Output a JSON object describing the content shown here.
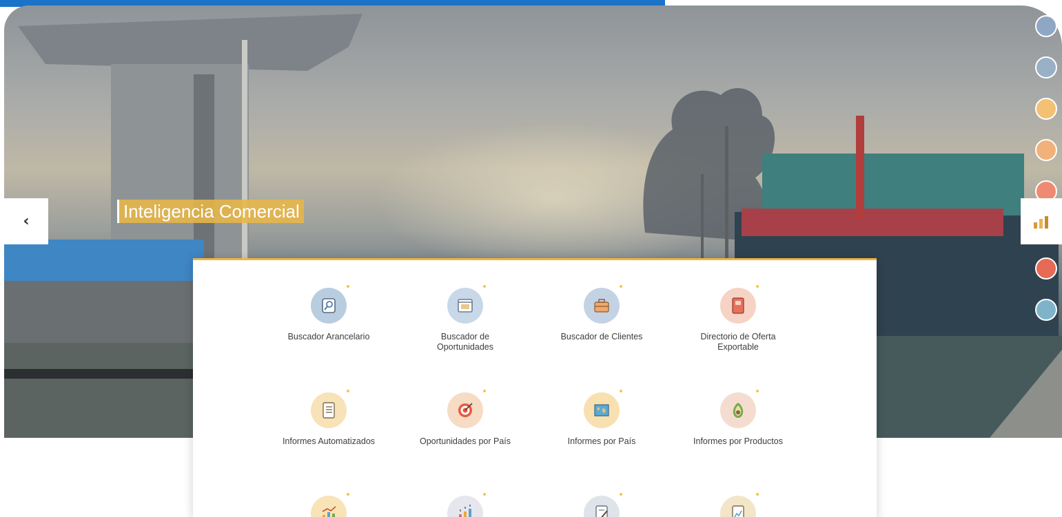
{
  "hero": {
    "title": "Inteligencia Comercial",
    "prev_arrow": "‹"
  },
  "right_nav": [
    {
      "icon": "search-doc-icon",
      "color": "#8fa7c4"
    },
    {
      "icon": "browser-window-icon",
      "color": "#9ab0c6"
    },
    {
      "icon": "report-list-icon",
      "color": "#f2c173"
    },
    {
      "icon": "briefcase-icon",
      "color": "#f0b27a"
    },
    {
      "icon": "directory-book-icon",
      "color": "#ef8a72"
    },
    {
      "icon": "bar-chart-icon",
      "color": "#e8b455"
    },
    {
      "icon": "target-icon",
      "color": "#e66a55"
    },
    {
      "icon": "world-map-icon",
      "color": "#7fb3c9"
    }
  ],
  "tools": [
    {
      "label": "Buscador Arancelario",
      "icon": "search-doc-icon",
      "color": "#b9cde0"
    },
    {
      "label": "Buscador de Oportunidades",
      "icon": "browser-window-icon",
      "color": "#c8d8e8"
    },
    {
      "label": "Buscador de Clientes",
      "icon": "briefcase-icon",
      "color": "#c4d3e4"
    },
    {
      "label": "Directorio de Oferta Exportable",
      "icon": "directory-book-icon",
      "color": "#f6d3c4"
    },
    {
      "label": "Informes Automatizados",
      "icon": "report-list-icon",
      "color": "#f8e3b8"
    },
    {
      "label": "Oportunidades por País",
      "icon": "target-icon",
      "color": "#f6dcc4"
    },
    {
      "label": "Informes por País",
      "icon": "world-map-icon",
      "color": "#f8e0b0"
    },
    {
      "label": "Informes por Productos",
      "icon": "avocado-icon",
      "color": "#f4ddd0"
    },
    {
      "label": "",
      "icon": "line-bar-chart-icon",
      "color": "#f8e4b6"
    },
    {
      "label": "",
      "icon": "growth-bar-chart-icon",
      "color": "#e6e6ee"
    },
    {
      "label": "",
      "icon": "document-pen-icon",
      "color": "#dfe3ea"
    },
    {
      "label": "",
      "icon": "document-chart-icon",
      "color": "#f3e6c8"
    }
  ]
}
